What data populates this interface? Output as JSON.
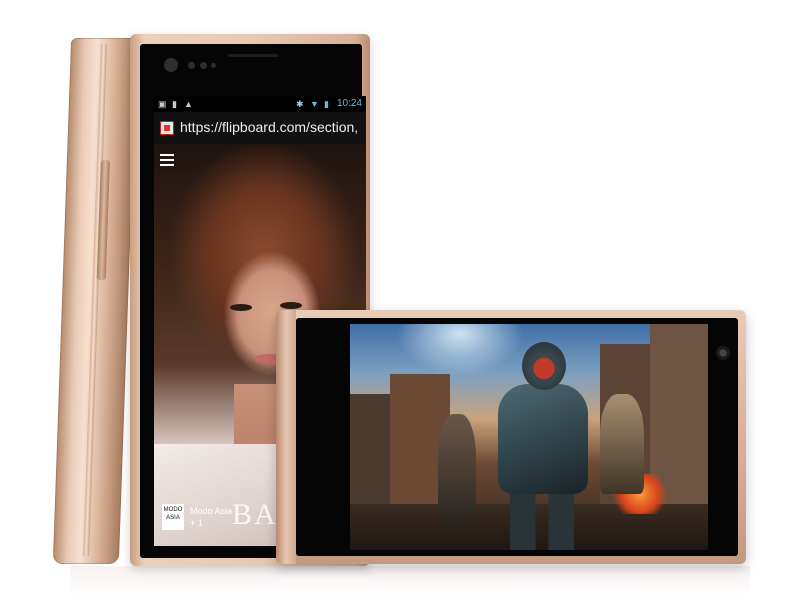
{
  "status_bar": {
    "time": "10:24"
  },
  "browser": {
    "url": "https://flipboard.com/section,"
  },
  "article": {
    "source_name": "Modo Asia",
    "plus_count": "+ 1",
    "logo_top": "MODO",
    "logo_bottom": "ASIA",
    "magazine_mark": "BAZ"
  },
  "icons": [
    "menu-icon",
    "image-notification-icon",
    "sd-card-icon",
    "warning-icon",
    "bluetooth-icon",
    "wifi-icon",
    "battery-icon",
    "favicon-icon",
    "front-camera-icon"
  ],
  "colors": {
    "device_gold": "#e6c6af",
    "screen_black": "#050505",
    "clock_blue": "#6ab8e8"
  }
}
